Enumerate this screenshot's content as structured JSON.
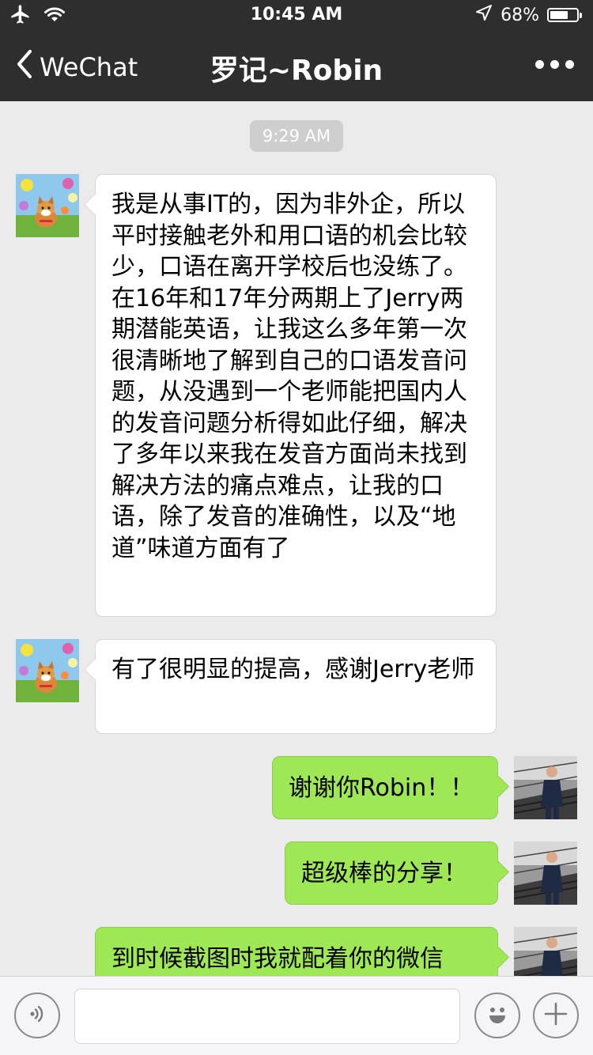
{
  "status_bar": {
    "time": "10:45 AM",
    "battery_text": "68%",
    "battery_level": 0.68,
    "icons": [
      "airplane-icon",
      "wifi-icon",
      "location-arrow-icon",
      "battery-icon"
    ]
  },
  "nav": {
    "back_label": "WeChat",
    "title": "罗记~Robin",
    "more_icon": "more-icon"
  },
  "chat": {
    "timestamp": "9:29 AM",
    "messages": [
      {
        "sender": "Robin",
        "direction": "incoming",
        "text": "我是从事IT的，因为非外企，所以平时接触老外和用口语的机会比较少，口语在离开学校后也没练了。在16年和17年分两期上了Jerry两期潜能英语，让我这么多年第一次很清晰地了解到自己的口语发音问题，从没遇到一个老师能把国内人的发音问题分析得如此仔细，解决了多年以来我在发音方面尚未找到解决方法的痛点难点，让我的口语，除了发音的准确性，以及“地道”味道方面有了"
      },
      {
        "sender": "Robin",
        "direction": "incoming",
        "text": "有了很明显的提高，感谢Jerry老师"
      },
      {
        "sender": "me",
        "direction": "outgoing",
        "text": "谢谢你Robin！！"
      },
      {
        "sender": "me",
        "direction": "outgoing",
        "text": "超级棒的分享！"
      },
      {
        "sender": "me",
        "direction": "outgoing",
        "text": "到时候截图时我就配着你的微信"
      }
    ]
  },
  "input_bar": {
    "voice_icon": "voice-icon",
    "emoji_icon": "emoji-icon",
    "plus_icon": "plus-icon",
    "text_value": ""
  },
  "colors": {
    "header_bg": "#2e2e2f",
    "chat_bg": "#ebebeb",
    "incoming_bubble": "#ffffff",
    "outgoing_bubble": "#9fe855",
    "timestamp_bg": "#cecece"
  }
}
